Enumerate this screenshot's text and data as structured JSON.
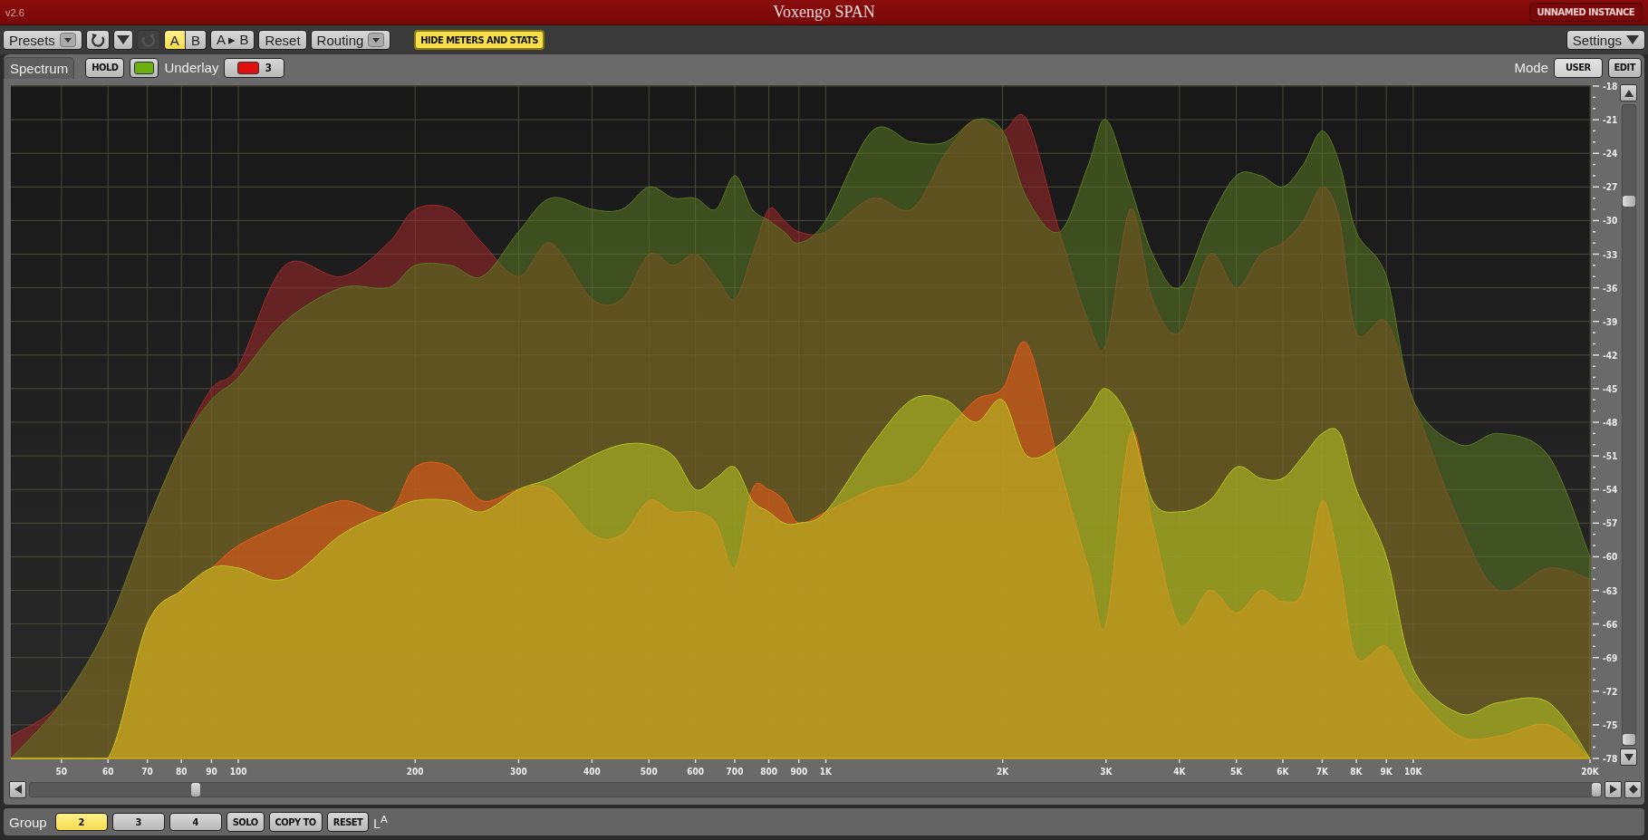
{
  "title_bar": {
    "version": "v2.6",
    "title": "Voxengo SPAN",
    "instance": "UNNAMED INSTANCE"
  },
  "toolbar": {
    "items": [
      {
        "kind": "dropdown",
        "label": "Presets"
      },
      {
        "kind": "undo",
        "disabled": false
      },
      {
        "kind": "menu",
        "disabled": false
      },
      {
        "kind": "redo",
        "disabled": true
      },
      {
        "kind": "ab",
        "options": [
          {
            "label": "A",
            "selected": true
          },
          {
            "label": "B",
            "selected": false
          }
        ]
      },
      {
        "kind": "button",
        "label": "A ▸ B"
      },
      {
        "kind": "button",
        "label": "Reset"
      },
      {
        "kind": "dropdown",
        "label": "Routing"
      },
      {
        "kind": "highlight",
        "label": "HIDE METERS AND STATS"
      }
    ],
    "settings": "Settings"
  },
  "spectrum": {
    "tab": "Spectrum",
    "hold": "HOLD",
    "hold_swatch": {
      "color": "#6cb010"
    },
    "underlay_label": "Underlay",
    "underlay": {
      "color": "#e01010",
      "value": "3"
    },
    "mode_label": "Mode",
    "mode_buttons": [
      {
        "label": "USER",
        "selected": true
      },
      {
        "label": "EDIT",
        "selected": false
      }
    ],
    "frequency_labels": [
      "50",
      "60",
      "70",
      "80",
      "90",
      "100",
      "200",
      "300",
      "400",
      "500",
      "600",
      "700",
      "800",
      "900",
      "1K",
      "2K",
      "3K",
      "4K",
      "5K",
      "6K",
      "7K",
      "8K",
      "9K",
      "10K",
      "20K"
    ],
    "level_labels": [
      "-18",
      "-21",
      "-24",
      "-27",
      "-30",
      "-33",
      "-36",
      "-39",
      "-42",
      "-45",
      "-48",
      "-51",
      "-54",
      "-57",
      "-60",
      "-63",
      "-66",
      "-69",
      "-72",
      "-75",
      "-78"
    ]
  },
  "group_bar": {
    "label": "Group",
    "groups": [
      {
        "label": "2",
        "selected": true
      },
      {
        "label": "3",
        "selected": false
      },
      {
        "label": "4",
        "selected": false
      }
    ],
    "buttons": [
      "SOLO",
      "COPY TO",
      "RESET"
    ],
    "channel": "L$^{A}$"
  }
}
